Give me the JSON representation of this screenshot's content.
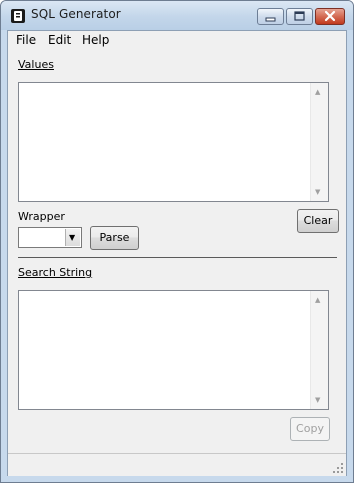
{
  "window": {
    "title": "SQL Generator"
  },
  "menu": {
    "items": [
      "File",
      "Edit",
      "Help"
    ]
  },
  "values": {
    "label": "Values"
  },
  "wrapper": {
    "label": "Wrapper",
    "selected": ""
  },
  "buttons": {
    "parse": "Parse",
    "clear": "Clear",
    "copy": "Copy"
  },
  "search": {
    "label": "Search String"
  },
  "icons": {
    "app": "app-icon",
    "minimize": "minimize-icon",
    "maximize": "maximize-icon",
    "close": "close-icon",
    "dropdown": "chevron-down-icon",
    "resize": "resize-grip-icon"
  }
}
